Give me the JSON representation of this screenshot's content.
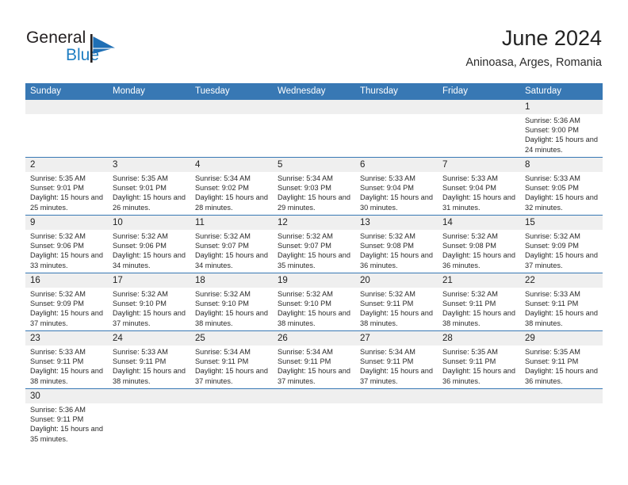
{
  "brand": {
    "name_part1": "General",
    "name_part2": "Blue",
    "logo_icon": "blue-flag-triangle",
    "accent_color": "#1f7ec2"
  },
  "header": {
    "title": "June 2024",
    "subtitle": "Aninoasa, Arges, Romania"
  },
  "theme": {
    "header_bg": "#3878b4",
    "datebar_bg": "#efefef",
    "separator": "#3878b4",
    "text": "#222222"
  },
  "weekday_headers": [
    "Sunday",
    "Monday",
    "Tuesday",
    "Wednesday",
    "Thursday",
    "Friday",
    "Saturday"
  ],
  "weeks": [
    {
      "days": [
        {
          "date": "",
          "lines": []
        },
        {
          "date": "",
          "lines": []
        },
        {
          "date": "",
          "lines": []
        },
        {
          "date": "",
          "lines": []
        },
        {
          "date": "",
          "lines": []
        },
        {
          "date": "",
          "lines": []
        },
        {
          "date": "1",
          "lines": [
            "Sunrise: 5:36 AM",
            "Sunset: 9:00 PM",
            "Daylight: 15 hours and 24 minutes."
          ]
        }
      ]
    },
    {
      "days": [
        {
          "date": "2",
          "lines": [
            "Sunrise: 5:35 AM",
            "Sunset: 9:01 PM",
            "Daylight: 15 hours and 25 minutes."
          ]
        },
        {
          "date": "3",
          "lines": [
            "Sunrise: 5:35 AM",
            "Sunset: 9:01 PM",
            "Daylight: 15 hours and 26 minutes."
          ]
        },
        {
          "date": "4",
          "lines": [
            "Sunrise: 5:34 AM",
            "Sunset: 9:02 PM",
            "Daylight: 15 hours and 28 minutes."
          ]
        },
        {
          "date": "5",
          "lines": [
            "Sunrise: 5:34 AM",
            "Sunset: 9:03 PM",
            "Daylight: 15 hours and 29 minutes."
          ]
        },
        {
          "date": "6",
          "lines": [
            "Sunrise: 5:33 AM",
            "Sunset: 9:04 PM",
            "Daylight: 15 hours and 30 minutes."
          ]
        },
        {
          "date": "7",
          "lines": [
            "Sunrise: 5:33 AM",
            "Sunset: 9:04 PM",
            "Daylight: 15 hours and 31 minutes."
          ]
        },
        {
          "date": "8",
          "lines": [
            "Sunrise: 5:33 AM",
            "Sunset: 9:05 PM",
            "Daylight: 15 hours and 32 minutes."
          ]
        }
      ]
    },
    {
      "days": [
        {
          "date": "9",
          "lines": [
            "Sunrise: 5:32 AM",
            "Sunset: 9:06 PM",
            "Daylight: 15 hours and 33 minutes."
          ]
        },
        {
          "date": "10",
          "lines": [
            "Sunrise: 5:32 AM",
            "Sunset: 9:06 PM",
            "Daylight: 15 hours and 34 minutes."
          ]
        },
        {
          "date": "11",
          "lines": [
            "Sunrise: 5:32 AM",
            "Sunset: 9:07 PM",
            "Daylight: 15 hours and 34 minutes."
          ]
        },
        {
          "date": "12",
          "lines": [
            "Sunrise: 5:32 AM",
            "Sunset: 9:07 PM",
            "Daylight: 15 hours and 35 minutes."
          ]
        },
        {
          "date": "13",
          "lines": [
            "Sunrise: 5:32 AM",
            "Sunset: 9:08 PM",
            "Daylight: 15 hours and 36 minutes."
          ]
        },
        {
          "date": "14",
          "lines": [
            "Sunrise: 5:32 AM",
            "Sunset: 9:08 PM",
            "Daylight: 15 hours and 36 minutes."
          ]
        },
        {
          "date": "15",
          "lines": [
            "Sunrise: 5:32 AM",
            "Sunset: 9:09 PM",
            "Daylight: 15 hours and 37 minutes."
          ]
        }
      ]
    },
    {
      "days": [
        {
          "date": "16",
          "lines": [
            "Sunrise: 5:32 AM",
            "Sunset: 9:09 PM",
            "Daylight: 15 hours and 37 minutes."
          ]
        },
        {
          "date": "17",
          "lines": [
            "Sunrise: 5:32 AM",
            "Sunset: 9:10 PM",
            "Daylight: 15 hours and 37 minutes."
          ]
        },
        {
          "date": "18",
          "lines": [
            "Sunrise: 5:32 AM",
            "Sunset: 9:10 PM",
            "Daylight: 15 hours and 38 minutes."
          ]
        },
        {
          "date": "19",
          "lines": [
            "Sunrise: 5:32 AM",
            "Sunset: 9:10 PM",
            "Daylight: 15 hours and 38 minutes."
          ]
        },
        {
          "date": "20",
          "lines": [
            "Sunrise: 5:32 AM",
            "Sunset: 9:11 PM",
            "Daylight: 15 hours and 38 minutes."
          ]
        },
        {
          "date": "21",
          "lines": [
            "Sunrise: 5:32 AM",
            "Sunset: 9:11 PM",
            "Daylight: 15 hours and 38 minutes."
          ]
        },
        {
          "date": "22",
          "lines": [
            "Sunrise: 5:33 AM",
            "Sunset: 9:11 PM",
            "Daylight: 15 hours and 38 minutes."
          ]
        }
      ]
    },
    {
      "days": [
        {
          "date": "23",
          "lines": [
            "Sunrise: 5:33 AM",
            "Sunset: 9:11 PM",
            "Daylight: 15 hours and 38 minutes."
          ]
        },
        {
          "date": "24",
          "lines": [
            "Sunrise: 5:33 AM",
            "Sunset: 9:11 PM",
            "Daylight: 15 hours and 38 minutes."
          ]
        },
        {
          "date": "25",
          "lines": [
            "Sunrise: 5:34 AM",
            "Sunset: 9:11 PM",
            "Daylight: 15 hours and 37 minutes."
          ]
        },
        {
          "date": "26",
          "lines": [
            "Sunrise: 5:34 AM",
            "Sunset: 9:11 PM",
            "Daylight: 15 hours and 37 minutes."
          ]
        },
        {
          "date": "27",
          "lines": [
            "Sunrise: 5:34 AM",
            "Sunset: 9:11 PM",
            "Daylight: 15 hours and 37 minutes."
          ]
        },
        {
          "date": "28",
          "lines": [
            "Sunrise: 5:35 AM",
            "Sunset: 9:11 PM",
            "Daylight: 15 hours and 36 minutes."
          ]
        },
        {
          "date": "29",
          "lines": [
            "Sunrise: 5:35 AM",
            "Sunset: 9:11 PM",
            "Daylight: 15 hours and 36 minutes."
          ]
        }
      ]
    },
    {
      "days": [
        {
          "date": "30",
          "lines": [
            "Sunrise: 5:36 AM",
            "Sunset: 9:11 PM",
            "Daylight: 15 hours and 35 minutes."
          ]
        },
        {
          "date": "",
          "lines": []
        },
        {
          "date": "",
          "lines": []
        },
        {
          "date": "",
          "lines": []
        },
        {
          "date": "",
          "lines": []
        },
        {
          "date": "",
          "lines": []
        },
        {
          "date": "",
          "lines": []
        }
      ]
    }
  ]
}
